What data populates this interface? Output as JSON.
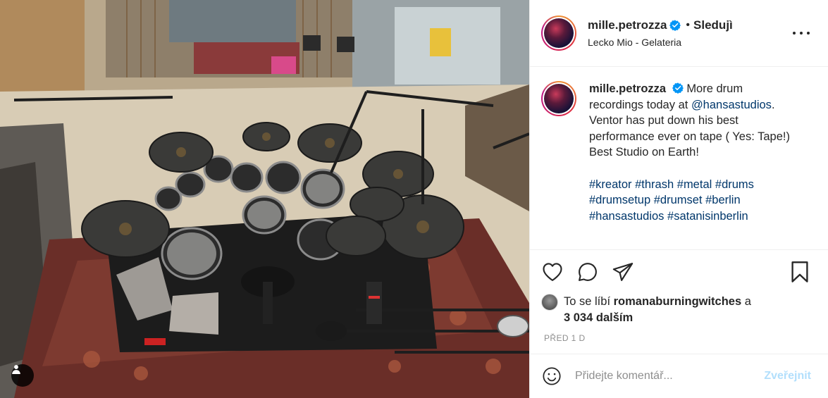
{
  "header": {
    "username": "mille.petrozza",
    "separator": "•",
    "follow_label": "Sledujì",
    "location": "Lecko Mio - Gelateria"
  },
  "caption": {
    "username": "mille.petrozza",
    "text": "More drum recordings today at",
    "mention": "@hansastudios",
    "text2": ". Ventor has put down his best performance ever on tape ( Yes: Tape!) Best Studio on Earth!",
    "hashtags_line1": [
      "#kreator",
      "#thrash",
      "#metal",
      "#drums"
    ],
    "hashtags_line2": [
      "#drumsetup",
      "#drumset",
      "#berlin"
    ],
    "hashtags_line3": [
      "#hansastudios",
      "#satanisinberlin"
    ]
  },
  "likes": {
    "prefix": "To se líbí",
    "liker": "romanaburningwitches",
    "connector": "a",
    "count": "3 034 dalším"
  },
  "timestamp": "PŘED 1 D",
  "comment_box": {
    "placeholder": "Přidejte komentář...",
    "post_label": "Zveřejnit"
  },
  "icons": {
    "verified": "verified-badge-icon",
    "more": "more-options-icon",
    "like": "heart-icon",
    "comment": "comment-icon",
    "share": "paper-plane-icon",
    "save": "bookmark-icon",
    "emoji": "emoji-icon",
    "user_tags": "user-icon"
  },
  "colors": {
    "verified_blue": "#0095f6",
    "link": "#00376b",
    "muted": "#8e8e8e",
    "post_disabled": "#b2dffc"
  }
}
